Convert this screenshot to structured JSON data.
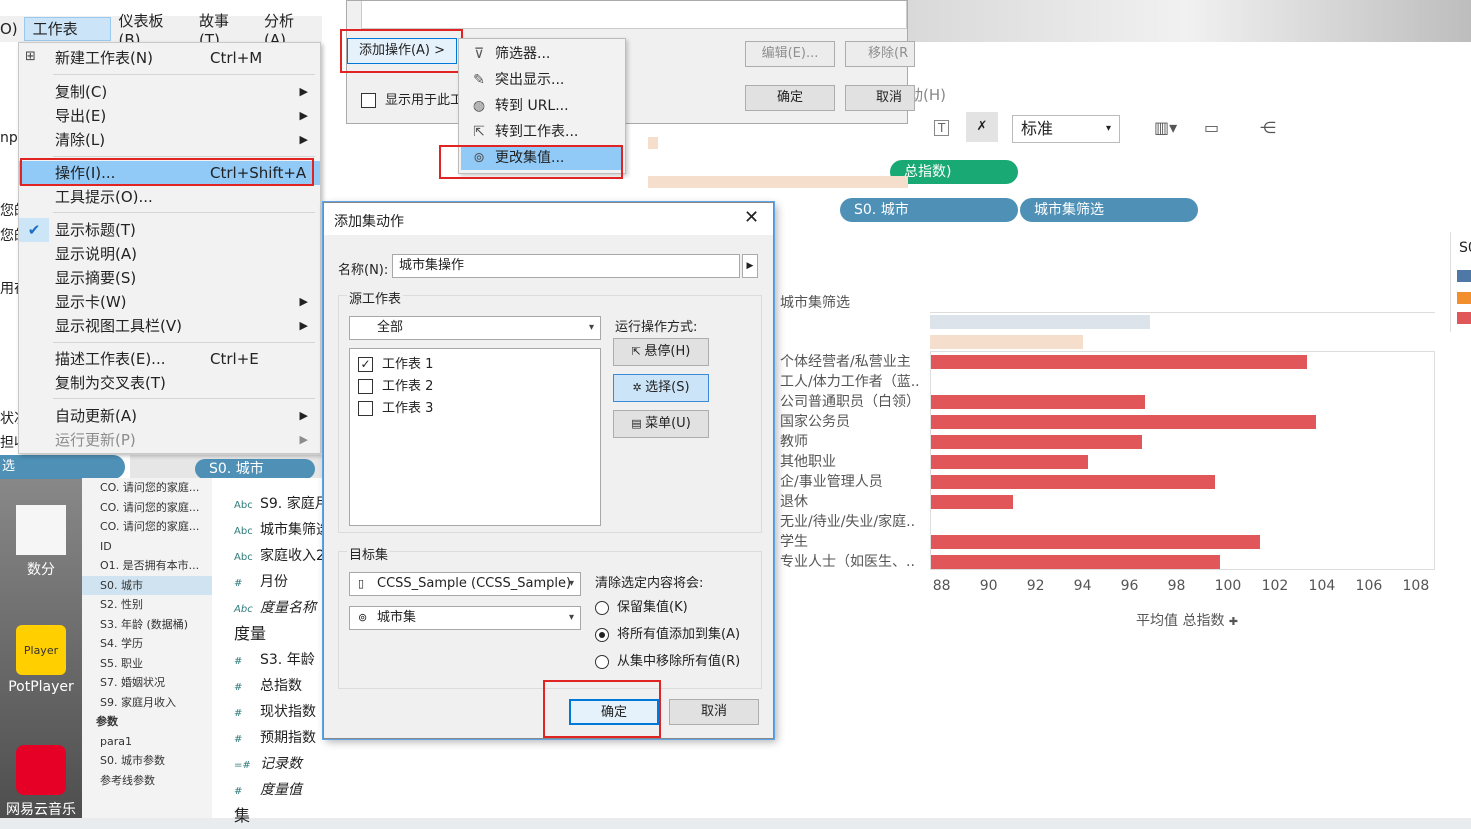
{
  "menubar": {
    "items": [
      "工作表(W)",
      "仪表板(B)",
      "故事(T)",
      "分析(A)"
    ],
    "fragment": "O)"
  },
  "worksheet_menu": {
    "items": [
      {
        "label": "新建工作表(N)",
        "shortcut": "Ctrl+M"
      },
      {
        "label": "复制(C)"
      },
      {
        "label": "导出(E)"
      },
      {
        "label": "清除(L)"
      },
      {
        "label": "操作(I)...",
        "shortcut": "Ctrl+Shift+A"
      },
      {
        "label": "工具提示(O)..."
      },
      {
        "label": "显示标题(T)"
      },
      {
        "label": "显示说明(A)"
      },
      {
        "label": "显示摘要(S)"
      },
      {
        "label": "显示卡(W)"
      },
      {
        "label": "显示视图工具栏(V)"
      },
      {
        "label": "描述工作表(E)...",
        "shortcut": "Ctrl+E"
      },
      {
        "label": "复制为交叉表(T)"
      },
      {
        "label": "自动更新(A)"
      },
      {
        "label": "运行更新(P)"
      }
    ]
  },
  "actions_dialog": {
    "add_action": "添加操作(A) >",
    "show_checkbox": "显示用于此工",
    "edit": "编辑(E)...",
    "remove": "移除(R",
    "ok": "确定",
    "cancel": "取消"
  },
  "submenu": {
    "items": [
      "筛选器...",
      "突出显示...",
      "转到 URL...",
      "转到工作表...",
      "更改集值..."
    ]
  },
  "set_dialog": {
    "title": "添加集动作",
    "name_label": "名称(N):",
    "name_value": "城市集操作",
    "source_label": "源工作表",
    "source_combo": "全部",
    "sheets": [
      {
        "label": "工作表 1",
        "checked": true
      },
      {
        "label": "工作表 2",
        "checked": false
      },
      {
        "label": "工作表 3",
        "checked": false
      }
    ],
    "run_label": "运行操作方式:",
    "run_buttons": [
      "悬停(H)",
      "选择(S)",
      "菜单(U)"
    ],
    "target_label": "目标集",
    "target_source": "CCSS_Sample (CCSS_Sample)",
    "target_set": "城市集",
    "clear_label": "清除选定内容将会:",
    "clear_options": [
      {
        "label": "保留集值(K)",
        "selected": false
      },
      {
        "label": "将所有值添加到集(A)",
        "selected": true
      },
      {
        "label": "从集中移除所有值(R)",
        "selected": false
      }
    ],
    "ok": "确定",
    "cancel": "取消"
  },
  "toolbar": {
    "standard": "标准",
    "menu_fragment": "动(H)"
  },
  "shelves": {
    "pill_green": "总指数)",
    "pill_city": "S0. 城市",
    "pill_city_filter": "城市集筛选",
    "left_pill": "S0. 城市",
    "left_strip": "选"
  },
  "chart_data": {
    "type": "bar",
    "header": "城市集筛选",
    "categories": [
      "个体经营者/私营业主",
      "工人/体力工作者（蓝..",
      "公司普通职员（白领）",
      "国家公务员",
      "教师",
      "其他职业",
      "企/事业管理人员",
      "退休",
      "无业/待业/失业/家庭..",
      "学生",
      "专业人士（如医生、.."
    ],
    "values": [
      103.5,
      null,
      96.6,
      103.9,
      96.5,
      94.2,
      99.6,
      91.0,
      null,
      101.5,
      99.8
    ],
    "xticks": [
      "88",
      "90",
      "92",
      "94",
      "96",
      "98",
      "100",
      "102",
      "104",
      "106",
      "108"
    ],
    "xlabel": "平均值 总指数",
    "xlim": [
      87.5,
      109
    ]
  },
  "legend": {
    "fragment": "S0"
  },
  "data_panel": {
    "items": [
      "CO. 请问您的家庭...",
      "CO. 请问您的家庭...",
      "CO. 请问您的家庭...",
      "ID",
      "O1. 是否拥有本市...",
      "S0. 城市",
      "S2. 性别",
      "S3. 年龄 (数据桶)",
      "S4. 学历",
      "S5. 职业",
      "S7. 婚姻状况",
      "S9. 家庭月收入",
      "参数",
      "para1",
      "S0. 城市参数",
      "参考线参数"
    ]
  },
  "field_panel": {
    "dims": [
      {
        "icon": "Abc",
        "label": "S9. 家庭月"
      },
      {
        "icon": "Abc",
        "label": "城市集筛选"
      },
      {
        "icon": "Abc",
        "label": "家庭收入2"
      },
      {
        "icon": "#",
        "label": "月份"
      },
      {
        "icon": "Abc",
        "label": "度量名称"
      }
    ],
    "measures_header": "度量",
    "measures": [
      "S3. 年龄",
      "总指数",
      "现状指数",
      "预期指数",
      "记录数",
      "度量值"
    ],
    "cut": "集"
  },
  "desktop": {
    "icons": [
      "数分",
      "PotPlayer",
      "网易云音乐"
    ],
    "player_badge": "Player"
  },
  "left_fragments": [
    "np",
    "您的",
    "您的",
    "用在",
    "状况",
    "担收"
  ]
}
